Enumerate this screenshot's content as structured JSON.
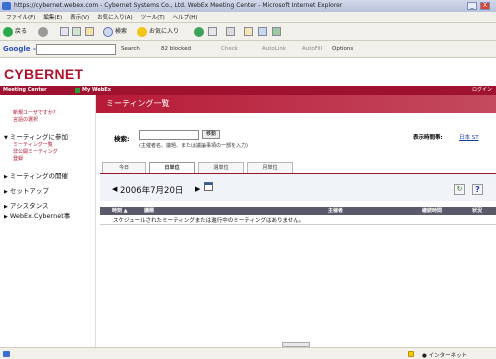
{
  "window": {
    "title": "https://cybernet.webex.com - Cybernet Systems Co., Ltd. WebEx Meeting Center - Microsoft Internet Explorer",
    "minimize": "_",
    "close": "X"
  },
  "menu": [
    "ファイル(F)",
    "編集(E)",
    "表示(V)",
    "お気に入り(A)",
    "ツール(T)",
    "ヘルプ(H)"
  ],
  "toolbar": {
    "back": "戻る",
    "search": "検索",
    "favorites": "お気に入り"
  },
  "googlebar": {
    "logo": "Google -",
    "search": "Search",
    "blocked": "82 blocked",
    "check": "Check",
    "autolink": "AutoLink",
    "autofill": "AutoFill",
    "options": "Options"
  },
  "brand": {
    "logo": "CYBERNET",
    "nav_meeting_center": "Meeting Center",
    "nav_my_webex": "My WebEx",
    "login": "ログイン"
  },
  "sidebar": {
    "links_top": [
      "新規ユーザですか?",
      "言語の選択"
    ],
    "section_join": "ミーティングに参加",
    "join_items": [
      "ミーティング一覧",
      "非公開ミーティング",
      "登録"
    ],
    "sections_collapsed": [
      "ミーティングの開催",
      "セットアップ",
      "アシスタンス",
      "WebEx.Cybernet事"
    ]
  },
  "main": {
    "page_title": "ミーティング一覧",
    "search_label": "検索:",
    "search_button": "移動",
    "search_hint": "(主催者名、議題、または議論事項の一部を入力)",
    "timezone_label": "表示時間帯:",
    "timezone_value": "日本 ST",
    "tabs": [
      "今日",
      "日単位",
      "週単位",
      "月単位"
    ],
    "active_tab": 1,
    "date_prev": "◀",
    "date": "2006年7月20日",
    "date_next": "▶",
    "table_headers": [
      "時刻 ▲",
      "議題",
      "主催者",
      "継続時間",
      "状況"
    ],
    "empty_message": "スケジュールされたミーティングまたは進行中のミーティングはありません。"
  },
  "statusbar": {
    "zone": "インターネット"
  },
  "colors": {
    "brand_red": "#b0122c",
    "nav_strip": "#9e1230",
    "link_blue": "#1a3fa8",
    "table_header": "#5a5a6a"
  }
}
